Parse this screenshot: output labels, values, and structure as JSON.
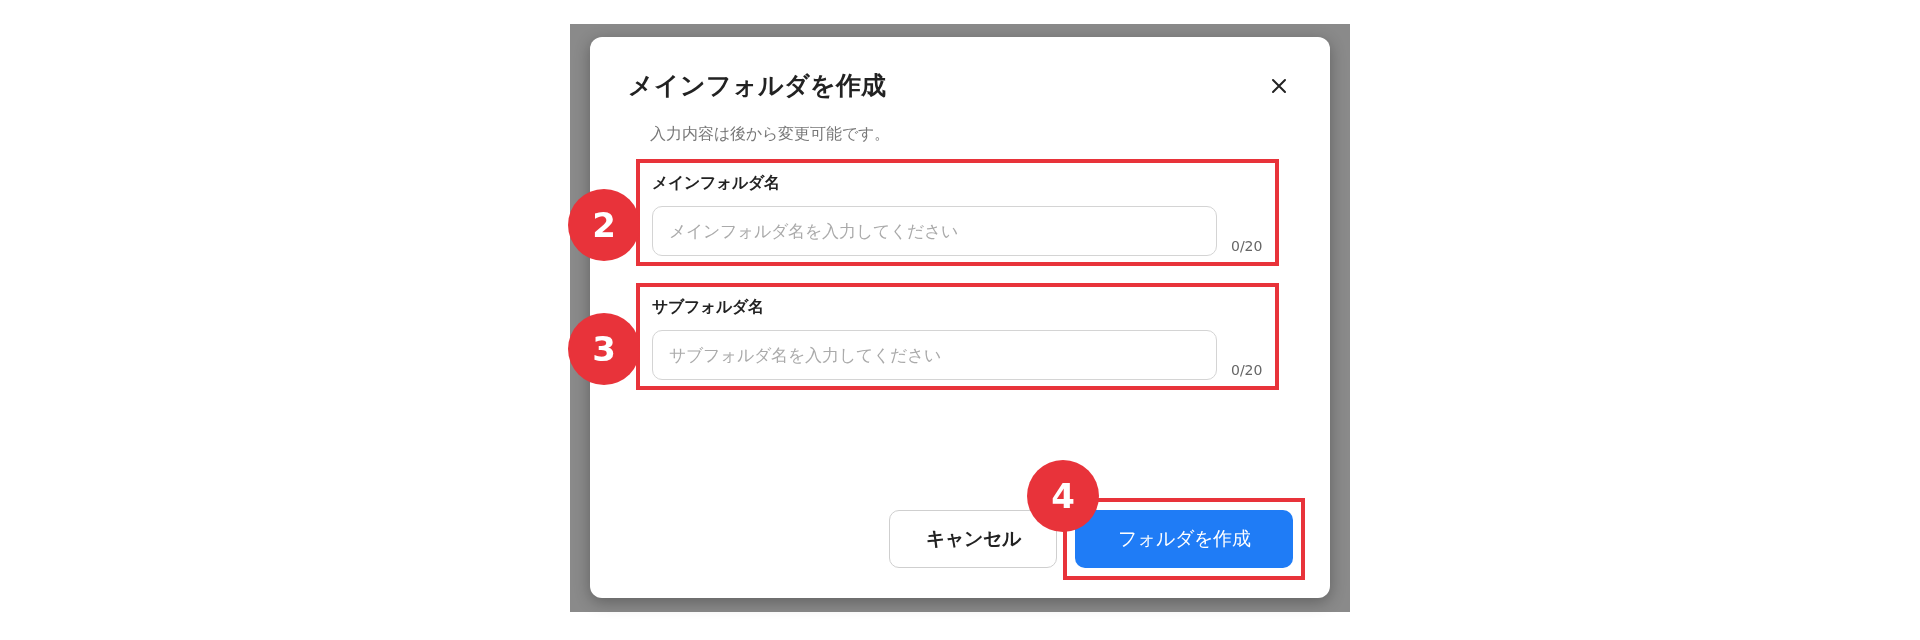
{
  "dialog": {
    "title": "メインフォルダを作成",
    "subtitle": "入力内容は後から変更可能です。",
    "fields": [
      {
        "label": "メインフォルダ名",
        "placeholder": "メインフォルダ名を入力してください",
        "counter": "0/20",
        "highlighted": true,
        "marker": "2"
      },
      {
        "label": "サブフォルダ名",
        "placeholder": "サブフォルダ名を入力してください",
        "counter": "0/20",
        "highlighted": true,
        "marker": "3"
      }
    ],
    "buttons": [
      {
        "label": "キャンセル",
        "kind": "secondary",
        "highlighted": false
      },
      {
        "label": "フォルダを作成",
        "kind": "primary",
        "highlighted": true,
        "marker": "4"
      }
    ]
  }
}
